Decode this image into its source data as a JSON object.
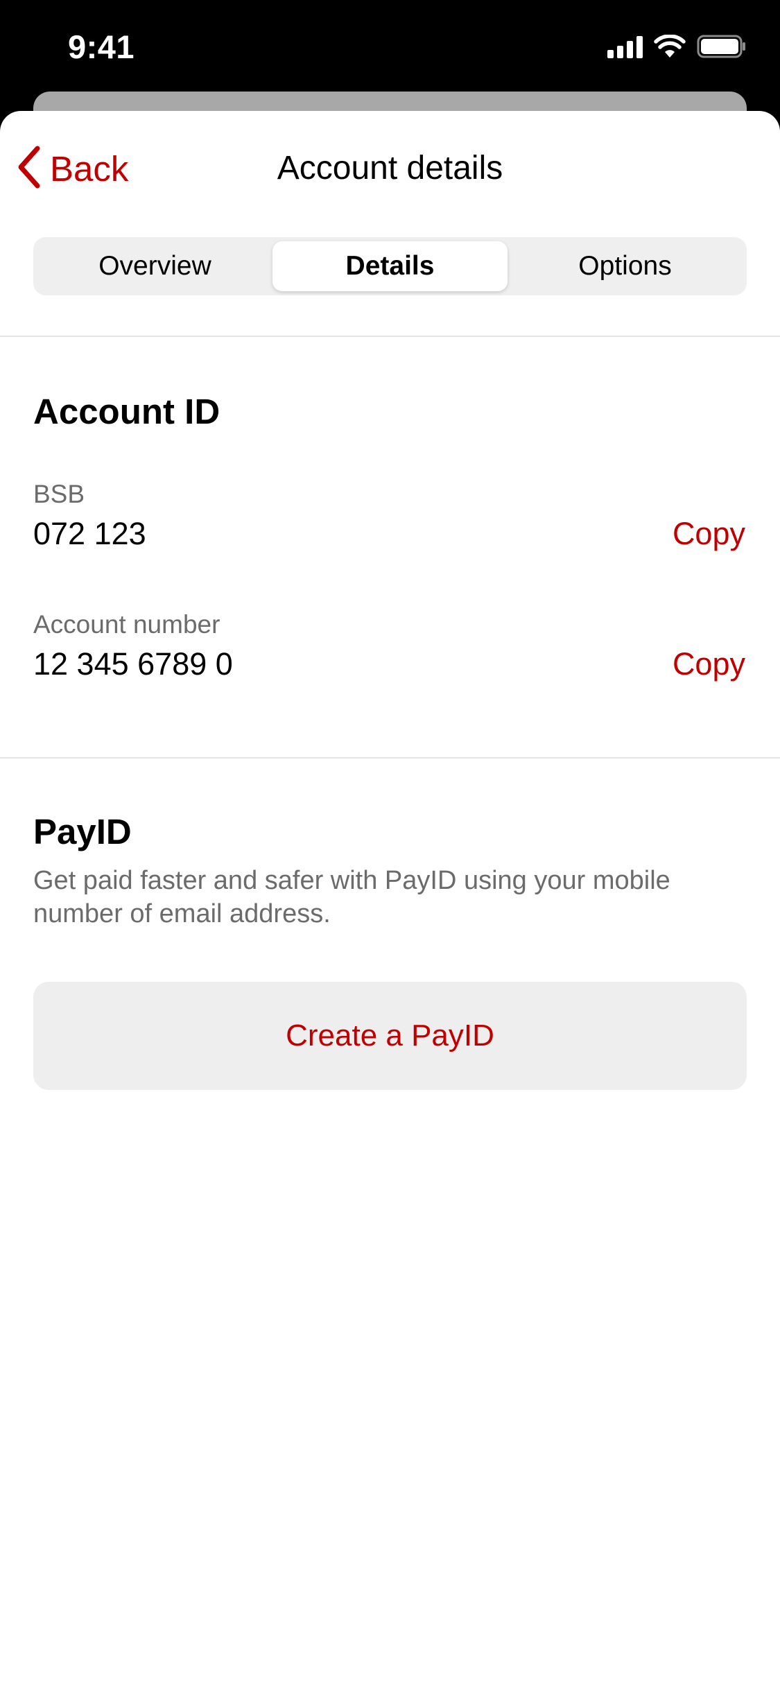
{
  "status_bar": {
    "time": "9:41",
    "icons": [
      "cellular-signal-icon",
      "wifi-icon",
      "battery-icon"
    ]
  },
  "nav": {
    "back_label": "Back",
    "back_icon": "chevron-left-icon",
    "title": "Account details"
  },
  "tabs": [
    {
      "label": "Overview",
      "active": false
    },
    {
      "label": "Details",
      "active": true
    },
    {
      "label": "Options",
      "active": false
    }
  ],
  "account_id": {
    "heading": "Account ID",
    "bsb": {
      "label": "BSB",
      "value": "072 123",
      "copy_label": "Copy"
    },
    "account_number": {
      "label": "Account number",
      "value": "12 345 6789 0",
      "copy_label": "Copy"
    }
  },
  "payid": {
    "heading": "PayID",
    "description": "Get paid faster and safer with PayID using your mobile number of email address.",
    "create_label": "Create a PayID"
  },
  "colors": {
    "accent": "#c00000",
    "secondary_text": "#6b6b6b",
    "segment_bg": "#efefef",
    "button_bg": "#eeeeee"
  }
}
